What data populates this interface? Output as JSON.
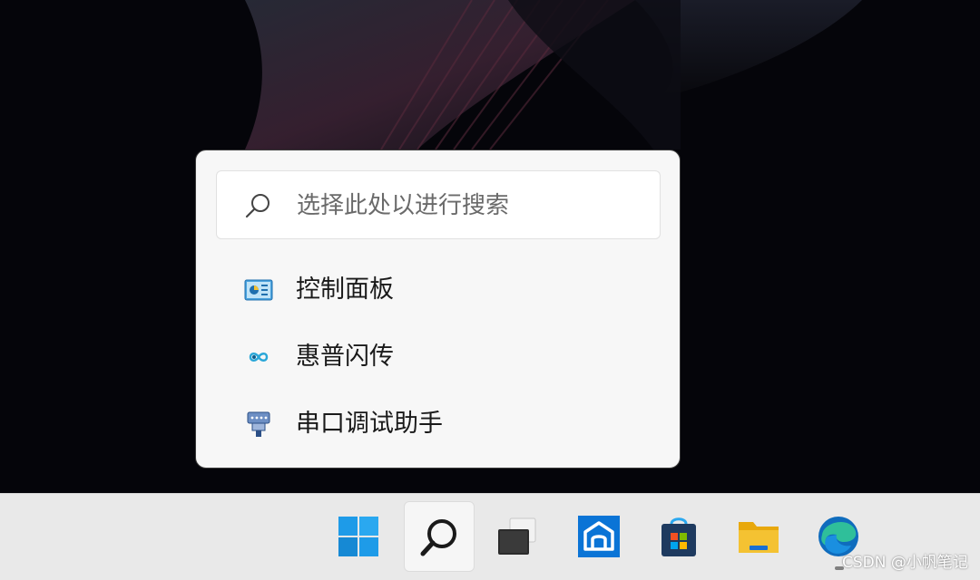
{
  "search_flyout": {
    "search_box": {
      "placeholder": "选择此处以进行搜索",
      "icon": "search-icon"
    },
    "recent_items": [
      {
        "label": "控制面板",
        "icon": "control-panel-icon"
      },
      {
        "label": "惠普闪传",
        "icon": "hp-quickdrop-icon"
      },
      {
        "label": "串口调试助手",
        "icon": "serial-port-icon"
      }
    ]
  },
  "taskbar": {
    "buttons": [
      {
        "name": "start",
        "icon": "windows-logo-icon"
      },
      {
        "name": "search",
        "icon": "search-icon",
        "active": true
      },
      {
        "name": "task-view",
        "icon": "task-view-icon"
      },
      {
        "name": "app",
        "icon": "house-app-icon"
      },
      {
        "name": "microsoft-store",
        "icon": "store-icon"
      },
      {
        "name": "file-explorer",
        "icon": "folder-icon"
      },
      {
        "name": "edge",
        "icon": "edge-icon"
      }
    ]
  },
  "watermark": "CSDN @小帆笔记",
  "colors": {
    "desktop_bg": "#05050a",
    "flyout_bg": "#f7f7f7",
    "taskbar_bg": "#e9e9e9",
    "windows_blue": "#1e9be8",
    "edge_teal": "#2fbf9a",
    "folder_yellow": "#f4c232",
    "store_dark": "#1e3a5f"
  }
}
